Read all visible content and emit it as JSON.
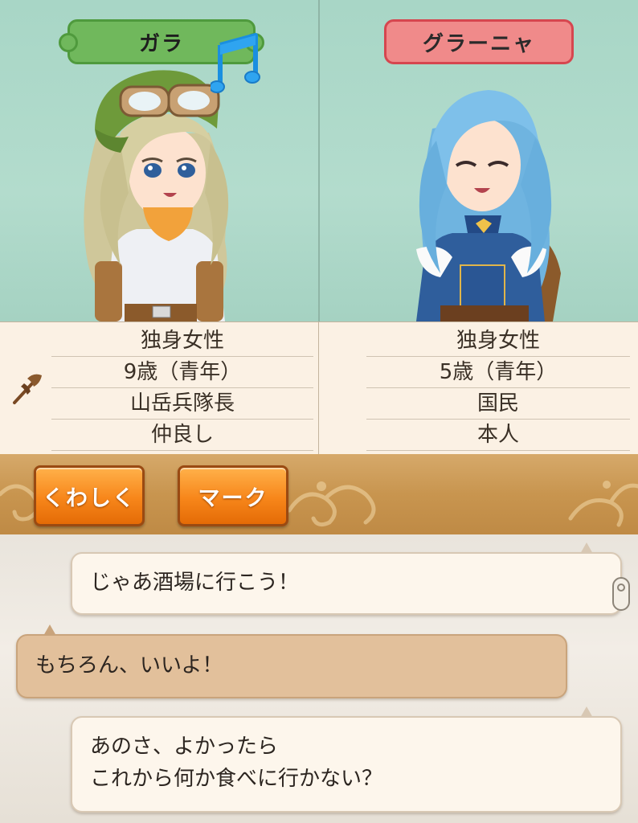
{
  "characters": {
    "left": {
      "name": "ガラ",
      "info": [
        "独身女性",
        "9歳（青年）",
        "山岳兵隊長",
        "仲良し"
      ],
      "emote_icon": "music-note-icon",
      "job_icon": "axe-icon"
    },
    "right": {
      "name": "グラーニャ",
      "info": [
        "独身女性",
        "5歳（青年）",
        "国民",
        "本人"
      ]
    }
  },
  "actions": {
    "details_label": "くわしく",
    "mark_label": "マーク"
  },
  "chat": {
    "messages": [
      {
        "speaker_side": "right",
        "lines": [
          "じゃあ酒場に行こう！"
        ]
      },
      {
        "speaker_side": "left",
        "lines": [
          "もちろん、いいよ！"
        ]
      },
      {
        "speaker_side": "right",
        "lines": [
          "あのさ、よかったら",
          "これから何か食べに行かない？"
        ]
      }
    ]
  },
  "colors": {
    "name_tag_left": "#70b85c",
    "name_tag_right": "#f08a8a",
    "button_orange": "#f7861a",
    "bar_gold": "#c8954f"
  }
}
